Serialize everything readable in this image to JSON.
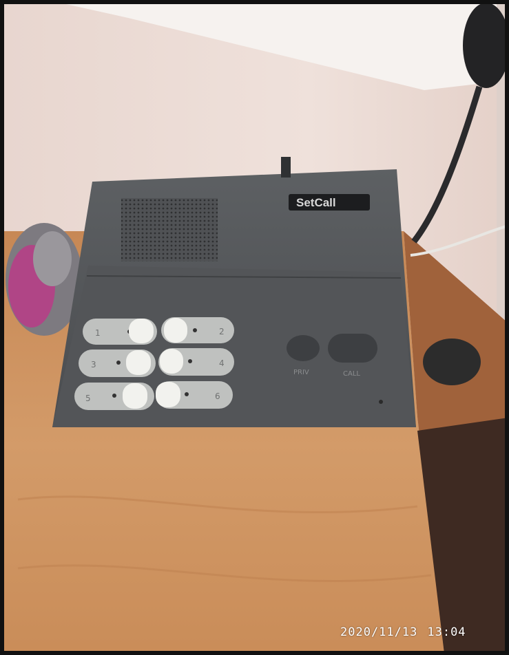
{
  "photo": {
    "brand_logo_text": "SetCall",
    "button_labels": [
      "1",
      "2",
      "3",
      "4",
      "5",
      "6"
    ],
    "control_labels": [
      "PRIV",
      "CALL"
    ],
    "timestamp_date": "2020/11/13",
    "timestamp_time": "13:04"
  },
  "palette": {
    "wall": "#e9d8d2",
    "desk": "#c98d5a",
    "device": "#545659",
    "keypad": "#bfc1bf",
    "button_cap": "#f2f2ee"
  }
}
